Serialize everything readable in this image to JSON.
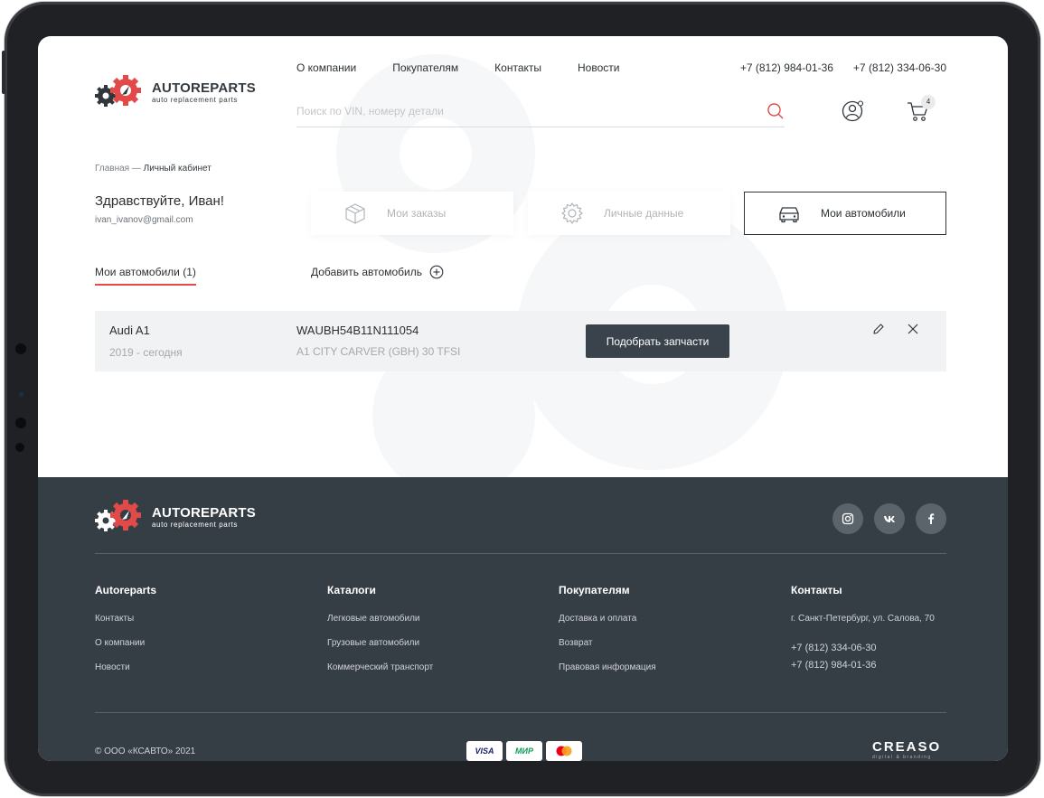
{
  "brand": {
    "name": "AUTOREPARTS",
    "tagline": "auto replacement parts"
  },
  "nav": [
    "О компании",
    "Покупателям",
    "Контакты",
    "Новости"
  ],
  "phones": [
    "+7 (812) 984-01-36",
    "+7 (812) 334-06-30"
  ],
  "search": {
    "placeholder": "Поиск по VIN, номеру детали"
  },
  "cart": {
    "count": "4"
  },
  "breadcrumb": {
    "home": "Главная",
    "sep": " — ",
    "current": "Личный кабинет"
  },
  "user": {
    "greeting": "Здравствуйте, Иван!",
    "email": "ivan_ivanov@gmail.com"
  },
  "tabs": [
    {
      "label": "Мои заказы",
      "icon": "box-icon"
    },
    {
      "label": "Личные данные",
      "icon": "gear-icon"
    },
    {
      "label": "Мои автомобили",
      "icon": "car-icon"
    }
  ],
  "subtabs": {
    "active": "Мои автомобили (1)",
    "add": "Добавить автомобиль"
  },
  "car": {
    "model": "Audi A1",
    "years": "2019 - сегодня",
    "vin": "WAUBH54B11N111054",
    "modification": "A1 CITY CARVER (GBH) 30 TFSI",
    "action": "Подобрать запчасти"
  },
  "footer": {
    "cols": [
      {
        "title": "Autoreparts",
        "links": [
          "Контакты",
          "О компании",
          "Новости"
        ]
      },
      {
        "title": "Каталоги",
        "links": [
          "Легковые автомобили",
          "Грузовые автомобили",
          "Коммерческий транспорт"
        ]
      },
      {
        "title": "Покупателям",
        "links": [
          "Доставка и оплата",
          "Возврат",
          "Правовая информация"
        ]
      }
    ],
    "contacts": {
      "title": "Контакты",
      "address": "г. Санкт-Петербург, ул. Салова, 70",
      "phones": [
        "+7 (812) 334-06-30",
        "+7 (812) 984-01-36"
      ]
    },
    "copyright": "© ООО «КСАВТО»  2021",
    "payments": [
      "VISA",
      "МИР"
    ],
    "developer": {
      "name": "CREASO",
      "sub": "digital & branding"
    }
  },
  "colors": {
    "accent": "#e24a4a",
    "dark": "#363e45",
    "button": "#3a434b"
  }
}
